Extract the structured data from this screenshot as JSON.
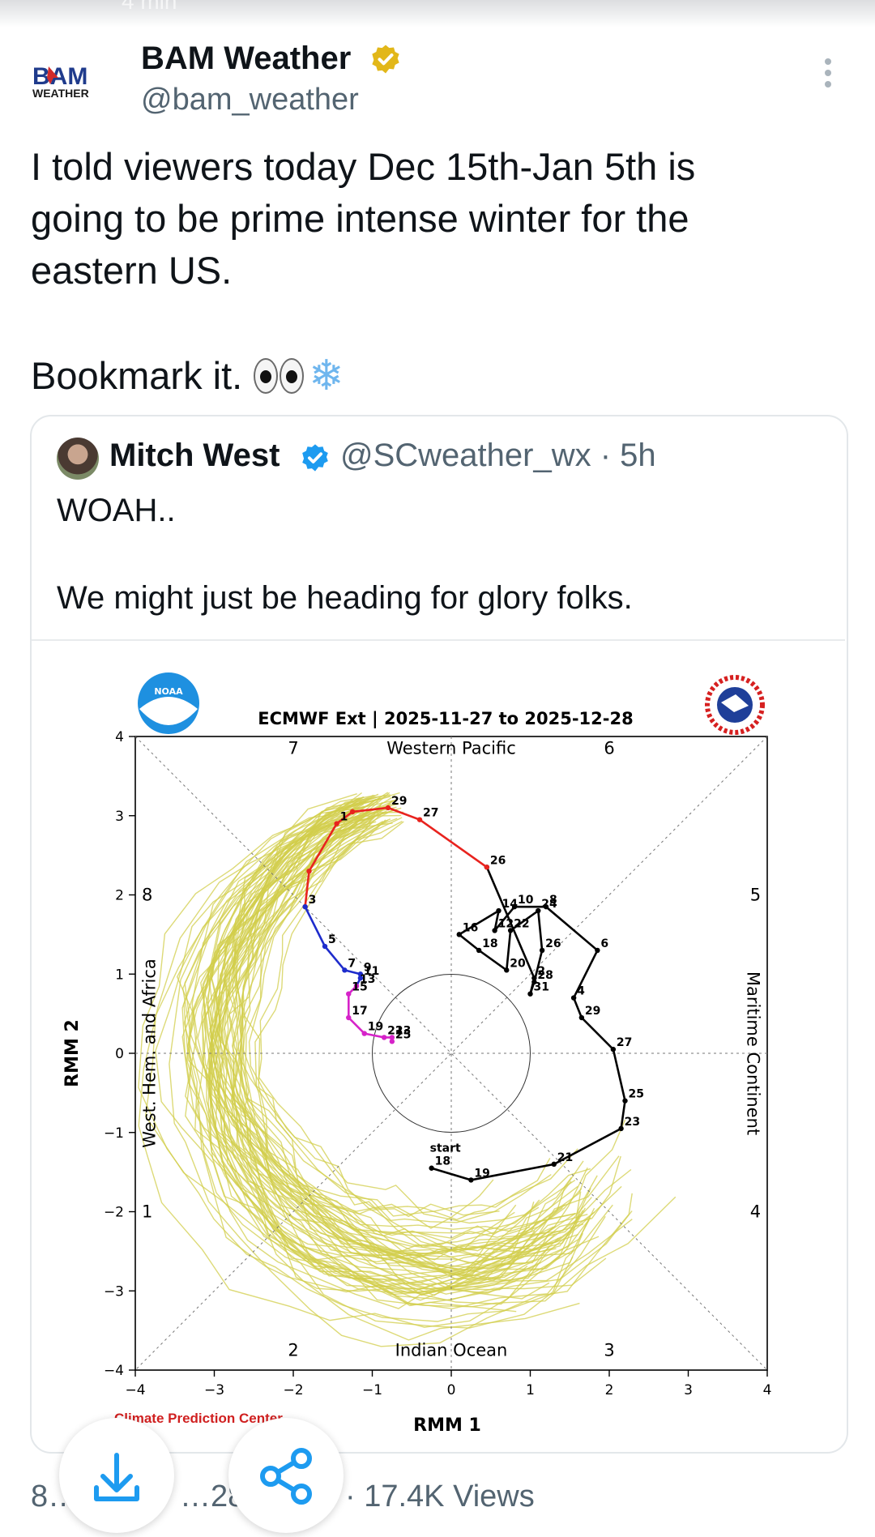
{
  "tweet": {
    "author_name": "BAM Weather",
    "author_handle": "@bam_weather",
    "text_lines": [
      "I told viewers today Dec 15th-Jan 5th is",
      "going to be prime intense winter for the",
      "eastern US."
    ],
    "text2": "Bookmark it.",
    "logo_text_top": "BAM",
    "logo_text_bottom": "WEATHER"
  },
  "quoted": {
    "author_name": "Mitch West",
    "author_handle": "@SCweather_wx · 5h",
    "text1": "WOAH..",
    "text2": "We might just be heading for glory folks."
  },
  "chart_data": {
    "type": "scatter",
    "title": "ECMWF Ext | 2025-11-27 to 2025-12-28",
    "xlabel": "RMM 1",
    "ylabel": "RMM 2",
    "xlim": [
      -4,
      4
    ],
    "ylim": [
      -4,
      4
    ],
    "xticks": [
      "−4",
      "−3",
      "−2",
      "−1",
      "0",
      "1",
      "2",
      "3",
      "4"
    ],
    "yticks": [
      "4",
      "3",
      "2",
      "1",
      "0",
      "−1",
      "−2",
      "−3",
      "−4"
    ],
    "phase_labels": [
      "7",
      "6",
      "8",
      "5",
      "1",
      "4",
      "2",
      "3"
    ],
    "region_labels": [
      "Western Pacific",
      "Maritime Continent",
      "Indian Ocean",
      "West. Hem. and Africa"
    ],
    "credit": "Climate Prediction Center",
    "logo_left": "NOAA",
    "series": [
      {
        "color": "#000000",
        "points": [
          {
            "x": -0.25,
            "y": -1.45,
            "label": "18",
            "extra": "start"
          },
          {
            "x": 0.25,
            "y": -1.6,
            "label": "19"
          },
          {
            "x": 1.3,
            "y": -1.4,
            "label": "21"
          },
          {
            "x": 2.15,
            "y": -0.95,
            "label": "23"
          },
          {
            "x": 2.2,
            "y": -0.6,
            "label": "25"
          },
          {
            "x": 2.05,
            "y": 0.05,
            "label": "27"
          },
          {
            "x": 1.65,
            "y": 0.45,
            "label": "29"
          },
          {
            "x": 1.55,
            "y": 0.7,
            "label": "4"
          },
          {
            "x": 1.85,
            "y": 1.3,
            "label": "6"
          },
          {
            "x": 1.2,
            "y": 1.85,
            "label": "8"
          },
          {
            "x": 0.8,
            "y": 1.85,
            "label": "10"
          },
          {
            "x": 0.55,
            "y": 1.55,
            "label": "12"
          },
          {
            "x": 0.6,
            "y": 1.8,
            "label": "14"
          },
          {
            "x": 0.1,
            "y": 1.5,
            "label": "16"
          },
          {
            "x": 0.35,
            "y": 1.3,
            "label": "18"
          },
          {
            "x": 0.7,
            "y": 1.05,
            "label": "20"
          },
          {
            "x": 0.75,
            "y": 1.55,
            "label": "22"
          },
          {
            "x": 1.1,
            "y": 1.8,
            "label": "24"
          },
          {
            "x": 1.15,
            "y": 1.3,
            "label": "26"
          },
          {
            "x": 1.05,
            "y": 0.9,
            "label": "28"
          },
          {
            "x": 1.0,
            "y": 0.75,
            "label": "31"
          },
          {
            "x": 1.05,
            "y": 0.95,
            "label": "2"
          },
          {
            "x": 0.45,
            "y": 2.35,
            "label": "26"
          }
        ]
      },
      {
        "color": "#e8231e",
        "points": [
          {
            "x": 0.45,
            "y": 2.35,
            "label": ""
          },
          {
            "x": -0.4,
            "y": 2.95,
            "label": "27"
          },
          {
            "x": -0.8,
            "y": 3.1,
            "label": "29"
          },
          {
            "x": -1.25,
            "y": 3.05,
            "label": ""
          },
          {
            "x": -1.45,
            "y": 2.9,
            "label": "1"
          },
          {
            "x": -1.8,
            "y": 2.3,
            "label": ""
          },
          {
            "x": -1.85,
            "y": 1.85,
            "label": "3"
          }
        ]
      },
      {
        "color": "#1e2ccc",
        "points": [
          {
            "x": -1.85,
            "y": 1.85,
            "label": ""
          },
          {
            "x": -1.6,
            "y": 1.35,
            "label": "5"
          },
          {
            "x": -1.35,
            "y": 1.05,
            "label": "7"
          },
          {
            "x": -1.15,
            "y": 1.0,
            "label": "9"
          },
          {
            "x": -1.15,
            "y": 0.95,
            "label": "11"
          },
          {
            "x": -1.2,
            "y": 0.85,
            "label": "13"
          }
        ]
      },
      {
        "color": "#d623c9",
        "points": [
          {
            "x": -1.2,
            "y": 0.85,
            "label": ""
          },
          {
            "x": -1.3,
            "y": 0.75,
            "label": "15"
          },
          {
            "x": -1.3,
            "y": 0.45,
            "label": "17"
          },
          {
            "x": -1.1,
            "y": 0.25,
            "label": "19"
          },
          {
            "x": -0.85,
            "y": 0.2,
            "label": "21"
          },
          {
            "x": -0.75,
            "y": 0.2,
            "label": "23"
          },
          {
            "x": -0.75,
            "y": 0.15,
            "label": "25"
          }
        ]
      }
    ]
  },
  "bottom": {
    "replies": "8…",
    "reposts": "…28",
    "views": "· 17.4K Views"
  },
  "colors": {
    "ensemble": "#d2cd4b",
    "accent": "#1d9bf0",
    "gold": "#e2b719"
  }
}
